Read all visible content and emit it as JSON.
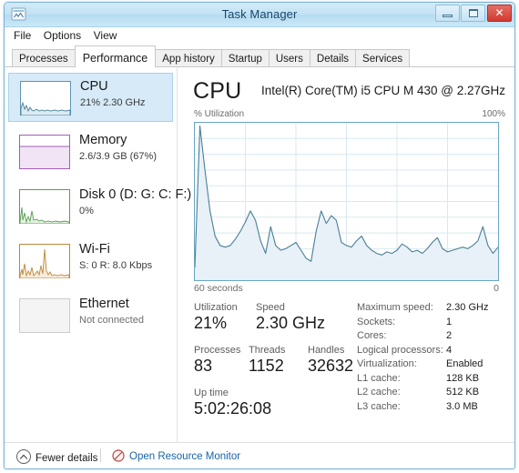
{
  "window": {
    "title": "Task Manager",
    "app_icon": "task-manager-icon",
    "controls": {
      "minimize": "minimize-icon",
      "maximize": "maximize-icon",
      "close": "✕"
    }
  },
  "menubar": {
    "items": [
      {
        "label": "File"
      },
      {
        "label": "Options"
      },
      {
        "label": "View"
      }
    ]
  },
  "tabs": [
    {
      "label": "Processes",
      "active": false
    },
    {
      "label": "Performance",
      "active": true
    },
    {
      "label": "App history",
      "active": false
    },
    {
      "label": "Startup",
      "active": false
    },
    {
      "label": "Users",
      "active": false
    },
    {
      "label": "Details",
      "active": false
    },
    {
      "label": "Services",
      "active": false
    }
  ],
  "sidebar": {
    "items": [
      {
        "name": "CPU",
        "sub": "21%  2.30 GHz",
        "selected": true,
        "accent": "#4a90b8",
        "fill": "#dceaf4"
      },
      {
        "name": "Memory",
        "sub": "2.6/3.9 GB (67%)",
        "selected": false,
        "accent": "#a05fb4",
        "fill": "#f0e4f5"
      },
      {
        "name": "Disk 0 (D: G: C: F:)",
        "sub": "0%",
        "selected": false,
        "accent": "#5a9e55",
        "fill": "#e6f2e4"
      },
      {
        "name": "Wi-Fi",
        "sub": "S: 0 R: 8.0 Kbps",
        "selected": false,
        "accent": "#c0873a",
        "fill": "#f6ecdc"
      },
      {
        "name": "Ethernet",
        "sub": "Not connected",
        "selected": false,
        "accent": "#b8b8b8",
        "fill": "#f4f4f4"
      }
    ]
  },
  "pane": {
    "title": "CPU",
    "cpu_name": "Intel(R) Core(TM) i5 CPU M 430 @ 2.27GHz",
    "axis_top_left": "% Utilization",
    "axis_top_right": "100%",
    "axis_bottom_left": "60 seconds",
    "axis_bottom_right": "0"
  },
  "chart_data": {
    "type": "area",
    "title": "% Utilization",
    "xlabel": "60 seconds",
    "ylabel": "% Utilization",
    "ylim": [
      0,
      100
    ],
    "xlim": [
      60,
      0
    ],
    "grid": true,
    "grid_rows": 10,
    "grid_cols": 6,
    "line_color": "#4a7f96",
    "fill_color": "#e8f1f7",
    "x": [
      60,
      59,
      58,
      57,
      56,
      55,
      54,
      53,
      52,
      51,
      50,
      49,
      48,
      47,
      46,
      45,
      44,
      43,
      42,
      41,
      40,
      39,
      38,
      37,
      36,
      35,
      34,
      33,
      32,
      31,
      30,
      29,
      28,
      27,
      26,
      25,
      24,
      23,
      22,
      21,
      20,
      19,
      18,
      17,
      16,
      15,
      14,
      13,
      12,
      11,
      10,
      9,
      8,
      7,
      6,
      5,
      4,
      3,
      2,
      1,
      0
    ],
    "values": [
      8,
      98,
      70,
      44,
      28,
      22,
      21,
      22,
      26,
      31,
      37,
      44,
      38,
      25,
      17,
      34,
      22,
      19,
      20,
      22,
      24,
      19,
      14,
      12,
      31,
      44,
      36,
      41,
      38,
      24,
      22,
      21,
      25,
      28,
      22,
      19,
      17,
      16,
      18,
      17,
      19,
      23,
      21,
      18,
      19,
      17,
      20,
      24,
      27,
      20,
      18,
      19,
      20,
      21,
      20,
      22,
      25,
      34,
      22,
      17,
      21
    ]
  },
  "stats": {
    "rows": [
      [
        {
          "label": "Utilization",
          "value": "21%"
        },
        {
          "label": "Speed",
          "value": "2.30 GHz"
        }
      ],
      [
        {
          "label": "Processes",
          "value": "83"
        },
        {
          "label": "Threads",
          "value": "1152"
        },
        {
          "label": "Handles",
          "value": "32632"
        }
      ]
    ],
    "uptime": {
      "label": "Up time",
      "value": "5:02:26:08"
    }
  },
  "specs": [
    {
      "key": "Maximum speed:",
      "value": "2.30 GHz"
    },
    {
      "key": "Sockets:",
      "value": "1"
    },
    {
      "key": "Cores:",
      "value": "2"
    },
    {
      "key": "Logical processors:",
      "value": "4"
    },
    {
      "key": "Virtualization:",
      "value": "Enabled"
    },
    {
      "key": "L1 cache:",
      "value": "128 KB"
    },
    {
      "key": "L2 cache:",
      "value": "512 KB"
    },
    {
      "key": "L3 cache:",
      "value": "3.0 MB"
    }
  ],
  "statusbar": {
    "fewer_details": "Fewer details",
    "open_resource_monitor": "Open Resource Monitor"
  }
}
